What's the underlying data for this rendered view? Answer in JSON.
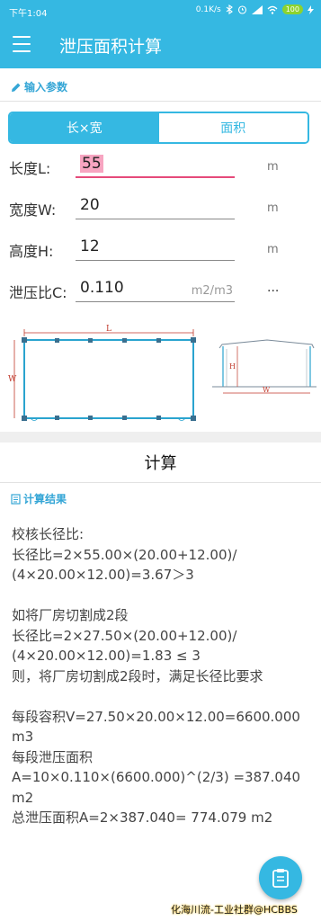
{
  "status_bar": {
    "time": "下午1:04",
    "net_speed": "0.1K/s",
    "battery": "100"
  },
  "app_bar": {
    "title": "泄压面积计算"
  },
  "input_section": {
    "title": "输入参数"
  },
  "mode_tabs": [
    {
      "label": "长×宽",
      "selected": true
    },
    {
      "label": "面积",
      "selected": false
    }
  ],
  "fields": {
    "length": {
      "label": "长度L:",
      "value": "55",
      "unit": "m"
    },
    "width": {
      "label": "宽度W:",
      "value": "20",
      "unit": "m"
    },
    "height": {
      "label": "高度H:",
      "value": "12",
      "unit": "m"
    },
    "ratio": {
      "label": "泄压比C:",
      "value": "0.110",
      "hint": "m2/m3",
      "more": "..."
    }
  },
  "diagram": {
    "plan_length": "L",
    "plan_width": "W",
    "elev_height": "H",
    "elev_width": "W"
  },
  "calculate_button": "计算",
  "result_section": {
    "title": "计算结果"
  },
  "results": {
    "lines1": [
      "校核长径比:",
      "长径比=2×55.00×(20.00+12.00)/",
      "(4×20.00×12.00)=3.67＞3"
    ],
    "lines2": [
      "如将厂房切割成2段",
      "长径比=2×27.50×(20.00+12.00)/",
      "(4×20.00×12.00)=1.83 ≤ 3",
      "则，将厂房切割成2段时，满足长径比要求"
    ],
    "lines3": [
      "每段容积V=27.50×20.00×12.00=6600.000",
      "m3",
      "每段泄压面积",
      "A=10×0.110×(6600.000)^(2/3) =387.040",
      "m2",
      "总泄压面积A=2×387.040= 774.079 m2"
    ]
  },
  "watermark": "化海川流-工业社群@HCBBS",
  "colors": {
    "primary": "#35b8e2",
    "active_field": "#e64a7a"
  }
}
